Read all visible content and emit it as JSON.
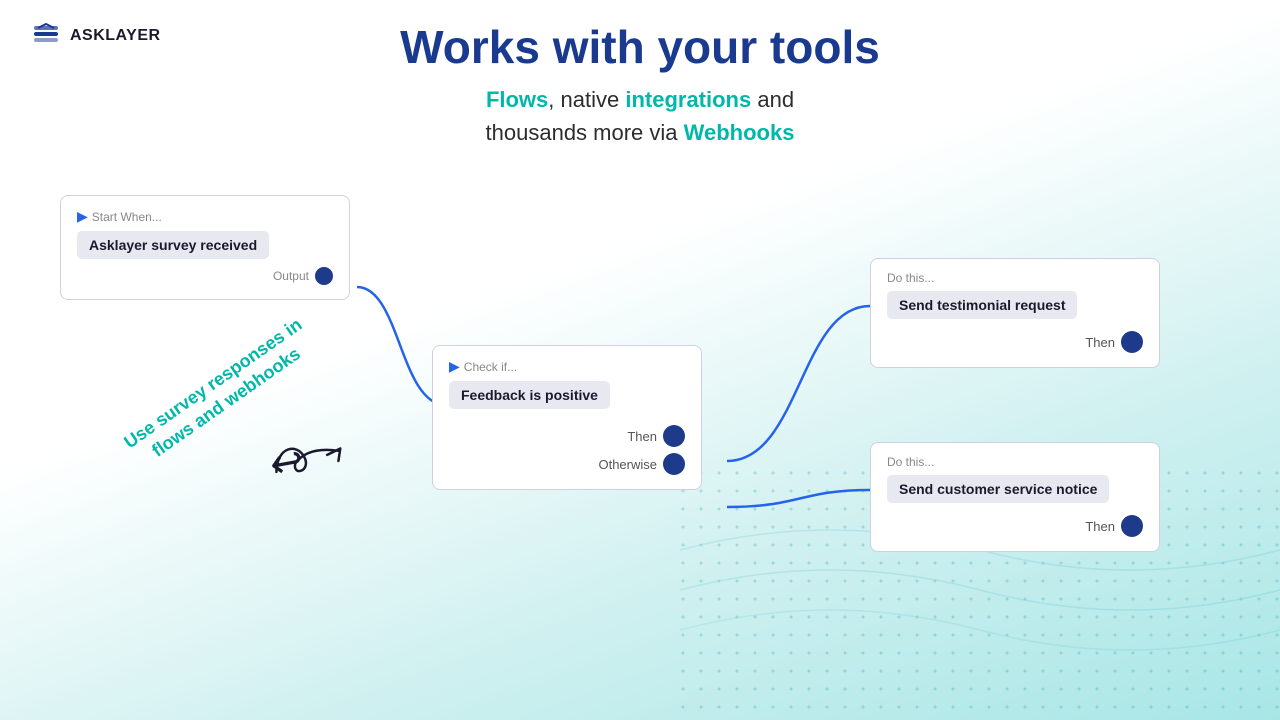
{
  "logo": {
    "text": "ASKLAYER"
  },
  "heading": {
    "main_title": "Works with your tools",
    "subtitle_part1": "Flows",
    "subtitle_text1": ", native ",
    "subtitle_part2": "integrations",
    "subtitle_text2": " and\nthousands more via ",
    "subtitle_part3": "Webhooks"
  },
  "diagonal_text": "Use survey responses\nin flows and webhooks",
  "start_box": {
    "label": "Start When...",
    "chip": "Asklayer survey received",
    "output_label": "Output"
  },
  "check_box": {
    "label": "Check if...",
    "chip": "Feedback is positive",
    "then_label": "Then",
    "otherwise_label": "Otherwise"
  },
  "do_top_box": {
    "label": "Do this...",
    "chip": "Send testimonial request",
    "then_label": "Then"
  },
  "do_bottom_box": {
    "label": "Do this...",
    "chip": "Send customer service notice",
    "then_label": "Then"
  }
}
